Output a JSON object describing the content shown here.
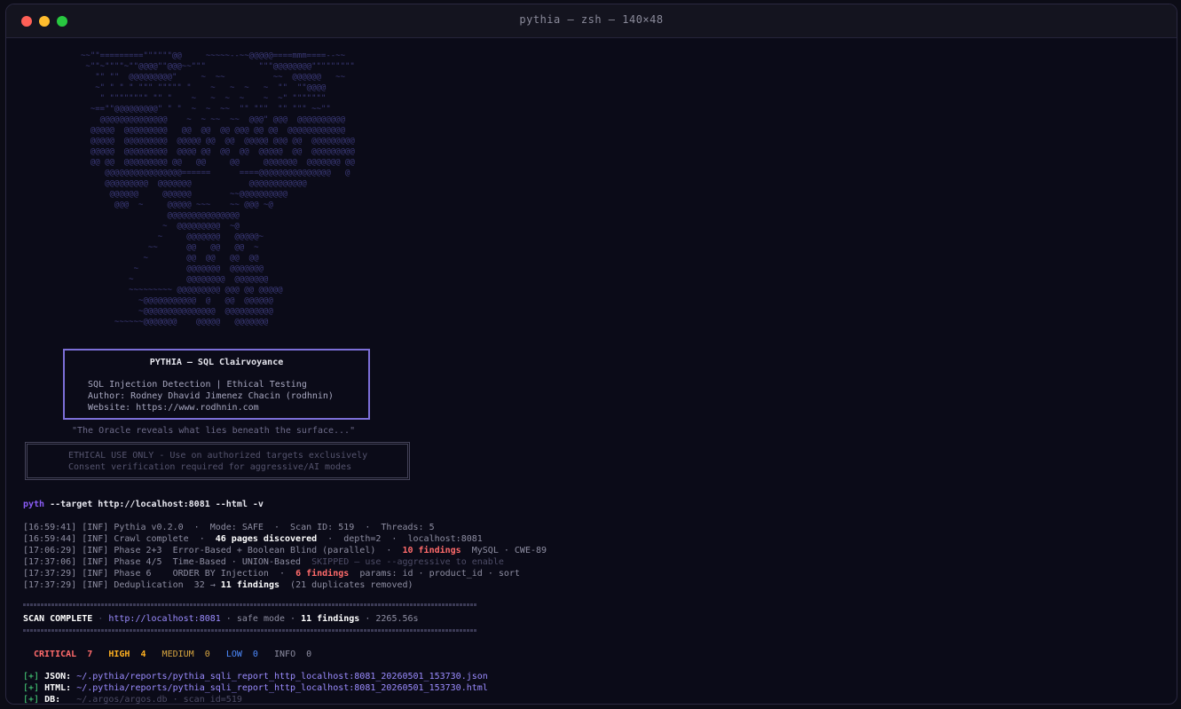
{
  "window": {
    "title": "pythia — zsh — 140×48"
  },
  "ascii_art": "~~\"\"=========\"\"\"\"\"\"@@     ~~~~~--~~@@@@@====mmm====--~~\n ~\"\"~\"\"\"\"~\"\"@@@@\"\"@@@~~\"\"\"           \"\"\"@@@@@@@@\"\"\"\"\"\"\"\"\"\n   \"\" \"\"  @@@@@@@@@\"     ~  ~~          ~~  @@@@@@   ~~\n   ~\" \" \" \" \"\"\" \"\"\"\"\" \"    ~   ~  ~   ~  \"\"  \"\"@@@@  \n    \" \"\"\"\"\"\"\"\" \"\" \"    ~   ~  ~  ~    ~  ~\" \"\"\"\"\"\"\"   \n  ~==\"\"@@@@@@@@@\" \" \"  ~  ~  ~~  \"\" \"\"\"  \"\" \"\"\" ~~\"\" \n    @@@@@@@@@@@@@@    ~  ~ ~~  ~~  @@@\" @@@  @@@@@@@@@@\n  @@@@@  @@@@@@@@@   @@  @@  @@ @@@ @@ @@  @@@@@@@@@@@@\n  @@@@@  @@@@@@@@@  @@@@@ @@  @@  @@@@@ @@@ @@  @@@@@@@@@\n  @@@@@  @@@@@@@@@  @@@@ @@  @@  @@  @@@@@  @@  @@@@@@@@@\n  @@ @@  @@@@@@@@@ @@   @@     @@     @@@@@@@  @@@@@@@ @@\n     @@@@@@@@@@@@@@@@======      ====@@@@@@@@@@@@@@@   @\n     @@@@@@@@@  @@@@@@@            @@@@@@@@@@@@\n      @@@@@@     @@@@@@        ~~@@@@@@@@@@\n       @@@  ~     @@@@@ ~~~    ~~ @@@ ~@\n                  @@@@@@@@@@@@@@@\n                 ~  @@@@@@@@@  ~@\n                ~     @@@@@@@   @@@@@~\n              ~~      @@   @@   @@  ~\n             ~        @@  @@   @@  @@\n           ~          @@@@@@@  @@@@@@@\n          ~           @@@@@@@@  @@@@@@@\n          ~~~~~~~~~ @@@@@@@@@ @@@ @@ @@@@@\n            ~@@@@@@@@@@@  @   @@  @@@@@@\n            ~@@@@@@@@@@@@@@@  @@@@@@@@@@\n       ~~~~~~@@@@@@@    @@@@@   @@@@@@@",
  "banner": {
    "title": "PYTHIA — SQL Clairvoyance",
    "line1": "SQL Injection Detection | Ethical Testing",
    "line2": "Author: Rodney Dhavid Jimenez Chacin (rodhnin)",
    "line3": "Website: https://www.rodhnin.com"
  },
  "tagline": "\"The Oracle reveals what lies beneath the surface...\"",
  "ethical": {
    "line1": "ETHICAL USE ONLY - Use on authorized targets exclusively",
    "line2": "Consent verification required for aggressive/AI modes"
  },
  "command": {
    "prompt": "pyth",
    "args": " --target http://localhost:8081 --html -v"
  },
  "log": [
    {
      "ts": "[16:59:41] [INF] ",
      "a": "Pythia v0.2.0  ·  Mode: SAFE  ·  Scan ID: 519  ·  Threads: 5"
    },
    {
      "ts": "[16:59:44] [INF] ",
      "a": "Crawl complete  ·  ",
      "b": "46 pages discovered",
      "c": "  ·  depth=2  ·  localhost:8081"
    },
    {
      "ts": "[17:06:29] [INF] ",
      "a": "Phase 2+3  Error-Based + Boolean Blind (parallel)  ·  ",
      "b": "10 findings",
      "c": "  MySQL · CWE-89"
    },
    {
      "ts": "[17:37:06] [INF] ",
      "a": "Phase 4/5  Time-Based · UNION-Based  ",
      "b": "SKIPPED — use --aggressive to enable"
    },
    {
      "ts": "[17:37:29] [INF] ",
      "a": "Phase 6    ORDER BY Injection  ·  ",
      "b": "6 findings",
      "c": "  params: id · product_id · sort"
    },
    {
      "ts": "[17:37:29] [INF] ",
      "a": "Deduplication  32 → ",
      "b": "11 findings",
      "c": "  (21 duplicates removed)"
    }
  ],
  "summary": {
    "label": "SCAN COMPLETE",
    "sep1": " · ",
    "url": "http://localhost:8081",
    "mode": " · safe mode · ",
    "findings": "11 findings",
    "time": " · 2265.56s"
  },
  "severity": {
    "critical_label": "CRITICAL",
    "critical": "7",
    "high_label": "HIGH",
    "high": "4",
    "medium_label": "MEDIUM",
    "medium": "0",
    "low_label": "LOW",
    "low": "0",
    "info_label": "INFO",
    "info": "0"
  },
  "outputs": [
    {
      "mark": "[+]",
      "label": " JSON: ",
      "path": "~/.pythia/reports/pythia_sqli_report_http_localhost:8081_20260501_153730.json"
    },
    {
      "mark": "[+]",
      "label": " HTML: ",
      "path": "~/.pythia/reports/pythia_sqli_report_http_localhost:8081_20260501_153730.html"
    },
    {
      "mark": "[+]",
      "label": " DB:   ",
      "path": "~/.argos/argos.db · scan_id=519"
    }
  ]
}
